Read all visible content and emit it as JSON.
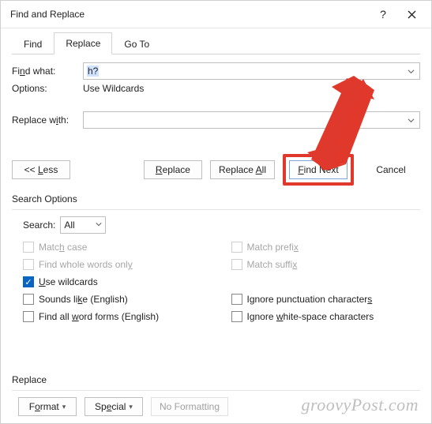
{
  "title": "Find and Replace",
  "tabs": {
    "find": "Find",
    "replace": "Replace",
    "goto": "Go To"
  },
  "find": {
    "label": "Find what:",
    "value": "h?",
    "options_label": "Options:",
    "options_value": "Use Wildcards"
  },
  "replace": {
    "label": "Replace with:",
    "value": ""
  },
  "buttons": {
    "less": "<< Less",
    "replace": "Replace",
    "replace_all": "Replace All",
    "find_next": "Find Next",
    "cancel": "Cancel"
  },
  "search_options": {
    "heading": "Search Options",
    "search_label": "Search:",
    "search_value": "All",
    "left": {
      "match_case": "Match case",
      "whole_words": "Find whole words only",
      "use_wildcards": "Use wildcards",
      "sounds_like": "Sounds like (English)",
      "word_forms": "Find all word forms (English)"
    },
    "right": {
      "match_prefix": "Match prefix",
      "match_suffix": "Match suffix",
      "ignore_punct": "Ignore punctuation characters",
      "ignore_ws": "Ignore white-space characters"
    }
  },
  "replace_section": {
    "heading": "Replace",
    "format": "Format",
    "special": "Special",
    "no_formatting": "No Formatting"
  },
  "watermark": "groovyPost.com"
}
